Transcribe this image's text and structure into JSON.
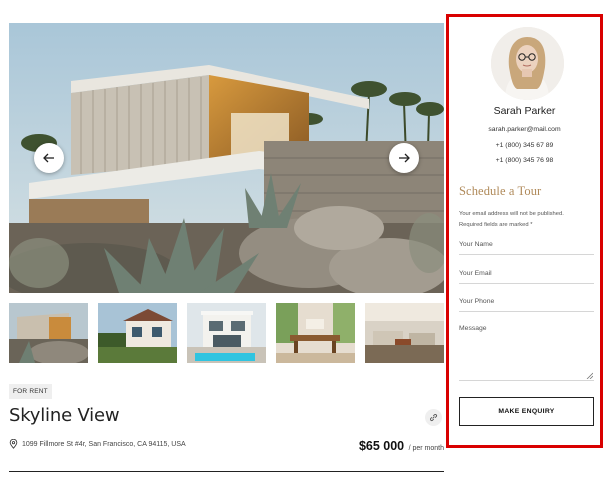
{
  "gallery": {
    "prev_icon": "arrow-left-icon",
    "next_icon": "arrow-right-icon",
    "thumbnails": [
      "thumbnail-1",
      "thumbnail-2",
      "thumbnail-3",
      "thumbnail-4",
      "thumbnail-5"
    ]
  },
  "listing": {
    "status_tag": "FOR RENT",
    "title": "Skyline View",
    "share_icon": "link-icon",
    "location_icon": "map-pin-icon",
    "address": "1099 Fillmore St #4r, San Francisco, CA 94115, USA",
    "price": "$65 000",
    "price_period": "/ per month"
  },
  "agent": {
    "name": "Sarah Parker",
    "email": "sarah.parker@mail.com",
    "phone_1": "+1 (800) 345 67 89",
    "phone_2": "+1 (800) 345 76 98"
  },
  "tour_form": {
    "title": "Schedule a Tour",
    "note_line_1": "Your email address will not be published.",
    "note_line_2": "Required fields are marked *",
    "name_placeholder": "Your Name",
    "email_placeholder": "Your Email",
    "phone_placeholder": "Your Phone",
    "message_placeholder": "Message",
    "submit_label": "MAKE ENQUIRY"
  },
  "colors": {
    "highlight_border": "#d90000",
    "form_title": "#b08a5a"
  }
}
